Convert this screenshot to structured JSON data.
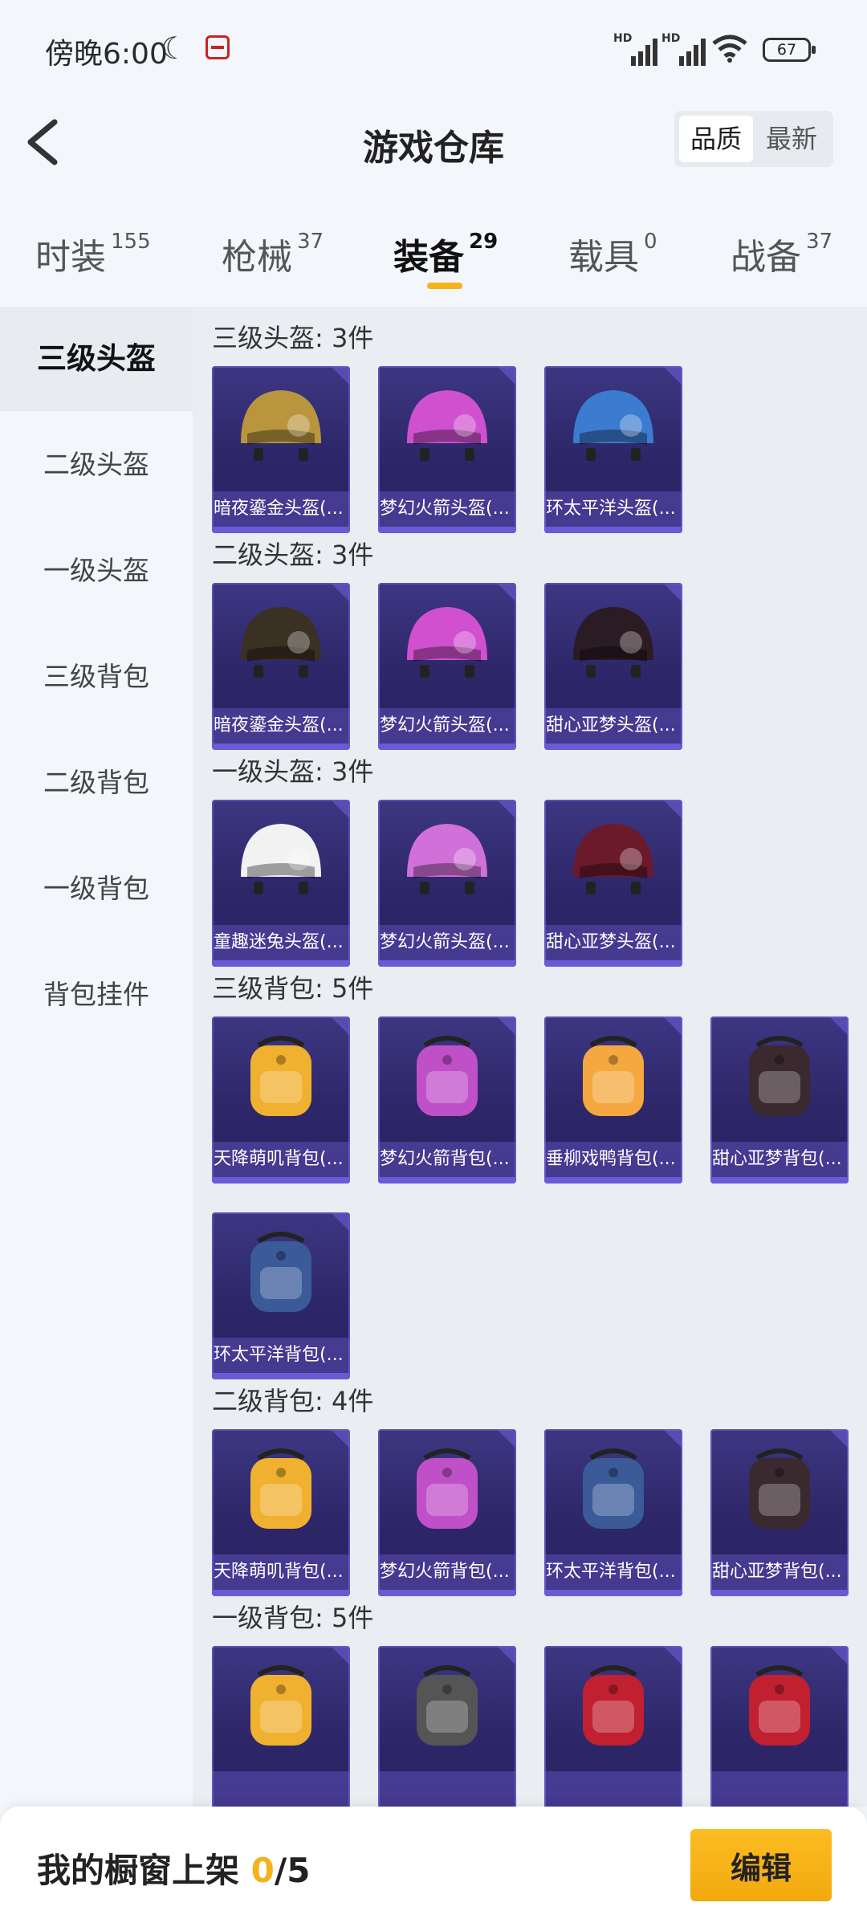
{
  "status_bar": {
    "time": "傍晚6:00",
    "battery": "67",
    "signal_label": "HD"
  },
  "header": {
    "title": "游戏仓库",
    "sort_options": [
      "品质",
      "最新"
    ]
  },
  "tabs": [
    {
      "label": "时装",
      "count": "155"
    },
    {
      "label": "枪械",
      "count": "37"
    },
    {
      "label": "装备",
      "count": "29"
    },
    {
      "label": "载具",
      "count": "0"
    },
    {
      "label": "战备",
      "count": "37"
    }
  ],
  "active_tab": "装备",
  "sidebar": {
    "items": [
      "三级头盔",
      "二级头盔",
      "一级头盔",
      "三级背包",
      "二级背包",
      "一级背包",
      "背包挂件"
    ],
    "active": "三级头盔"
  },
  "sections": [
    {
      "title": "三级头盔: 3件",
      "items": [
        {
          "name": "暗夜鎏金头盔(...",
          "icon": "golden-helmet-icon",
          "color": "#b9963e"
        },
        {
          "name": "梦幻火箭头盔(...",
          "icon": "rocket-helmet-icon",
          "color": "#d050d0"
        },
        {
          "name": "环太平洋头盔(...",
          "icon": "pacific-helmet-icon",
          "color": "#3b7bd0"
        }
      ]
    },
    {
      "title": "二级头盔: 3件",
      "items": [
        {
          "name": "暗夜鎏金头盔(...",
          "icon": "golden-helmet-icon",
          "color": "#3a3024"
        },
        {
          "name": "梦幻火箭头盔(...",
          "icon": "rocket-helmet-icon",
          "color": "#d050d0"
        },
        {
          "name": "甜心亚梦头盔(...",
          "icon": "cat-helmet-icon",
          "color": "#2b1b22"
        }
      ]
    },
    {
      "title": "一级头盔: 3件",
      "items": [
        {
          "name": "童趣迷兔头盔(...",
          "icon": "bunny-helmet-icon",
          "color": "#f2f2f2"
        },
        {
          "name": "梦幻火箭头盔(...",
          "icon": "rocket-helmet-icon",
          "color": "#d070d8"
        },
        {
          "name": "甜心亚梦头盔(...",
          "icon": "cat-helmet-icon",
          "color": "#6a1a2a"
        }
      ]
    },
    {
      "title": "三级背包: 5件",
      "items": [
        {
          "name": "天降萌叽背包(...",
          "icon": "yellow-backpack-icon",
          "color": "#f0b030"
        },
        {
          "name": "梦幻火箭背包(...",
          "icon": "rocket-backpack-icon",
          "color": "#c050c8"
        },
        {
          "name": "垂柳戏鸭背包(...",
          "icon": "duck-backpack-icon",
          "color": "#f5a840"
        },
        {
          "name": "甜心亚梦背包(...",
          "icon": "cat-backpack-icon",
          "color": "#3a2a30"
        },
        {
          "name": "环太平洋背包(...",
          "icon": "pacific-backpack-icon",
          "color": "#3a5a98"
        }
      ]
    },
    {
      "title": "二级背包: 4件",
      "items": [
        {
          "name": "天降萌叽背包(...",
          "icon": "yellow-backpack-icon",
          "color": "#f0b030"
        },
        {
          "name": "梦幻火箭背包(...",
          "icon": "rocket-backpack-icon",
          "color": "#c050c8"
        },
        {
          "name": "环太平洋背包(...",
          "icon": "pacific-backpack-icon",
          "color": "#3a5a98"
        },
        {
          "name": "甜心亚梦背包(...",
          "icon": "cat-backpack-icon",
          "color": "#3a2a30"
        }
      ]
    },
    {
      "title": "一级背包: 5件",
      "items": [
        {
          "name": "",
          "icon": "yellow-backpack-icon",
          "color": "#f0b030"
        },
        {
          "name": "",
          "icon": "rocket-backpack-icon",
          "color": "#555"
        },
        {
          "name": "",
          "icon": "cat-backpack-icon",
          "color": "#c02030"
        },
        {
          "name": "",
          "icon": "cat-backpack-icon",
          "color": "#c02030"
        }
      ]
    }
  ],
  "bottom": {
    "shelf_label": "我的橱窗上架",
    "shelf_count": "0",
    "shelf_total": "/5",
    "edit_label": "编辑"
  },
  "colors": {
    "accent": "#f5b21a",
    "card_bg": "#2d2668"
  }
}
